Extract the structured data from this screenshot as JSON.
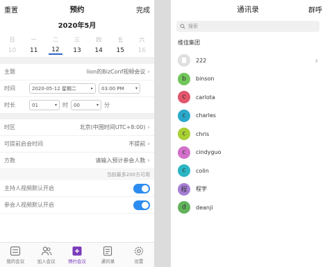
{
  "left": {
    "header": {
      "reset": "重置",
      "title": "预约",
      "done": "完成"
    },
    "month": "2020年5月",
    "weekdays": [
      "日",
      "一",
      "二",
      "三",
      "四",
      "五",
      "六"
    ],
    "days": [
      "10",
      "11",
      "12",
      "13",
      "14",
      "15",
      "16"
    ],
    "selected_day": "12",
    "subject": {
      "label": "主题",
      "value": "lion的BizConf视频会议"
    },
    "time": {
      "label": "时间",
      "date": "2020-05-12 星期二",
      "clock": "03:00 PM"
    },
    "duration": {
      "label": "时长",
      "hours": "01",
      "hours_unit": "时",
      "minutes": "00",
      "minutes_unit": "分"
    },
    "timezone": {
      "label": "时区",
      "value": "北京(中国时间UTC+8:00)"
    },
    "early_join": {
      "label": "可提前启会时间",
      "value": "不提前"
    },
    "capacity": {
      "label": "方数",
      "placeholder": "请输入预计参会人数"
    },
    "capacity_hint": "当前最多200方可用",
    "host_video": {
      "label": "主持人视频默认开启",
      "on": true
    },
    "participant_video": {
      "label": "参会人视频默认开启",
      "on": true
    },
    "tabs": [
      "我的会议",
      "加入会议",
      "预约会议",
      "通讯录",
      "设置"
    ]
  },
  "right": {
    "header": {
      "title": "通讯录",
      "right": "群呼"
    },
    "search": {
      "placeholder": "搜索"
    },
    "group": "维佳集团",
    "contacts": [
      {
        "initial": "",
        "name": "222",
        "color": "#d9d9d9",
        "chevron": true
      },
      {
        "initial": "b",
        "name": "binson",
        "color": "#72c55a",
        "chevron": false
      },
      {
        "initial": "c",
        "name": "carlota",
        "color": "#e1566b",
        "chevron": false
      },
      {
        "initial": "c",
        "name": "charles",
        "color": "#2aa8c9",
        "chevron": false
      },
      {
        "initial": "c",
        "name": "chris",
        "color": "#a8cf33",
        "chevron": false
      },
      {
        "initial": "c",
        "name": "cindyguo",
        "color": "#d270c9",
        "chevron": false
      },
      {
        "initial": "c",
        "name": "colin",
        "color": "#2cb5c3",
        "chevron": false
      },
      {
        "initial": "程",
        "name": "程宇",
        "color": "#a77fd6",
        "chevron": false
      },
      {
        "initial": "d",
        "name": "deanji",
        "color": "#62b25a",
        "chevron": false
      }
    ]
  },
  "colors": {
    "accent": "#2d8cf0",
    "selected_underline": "#2d62c8",
    "active_tab": "#7b3ab9"
  }
}
